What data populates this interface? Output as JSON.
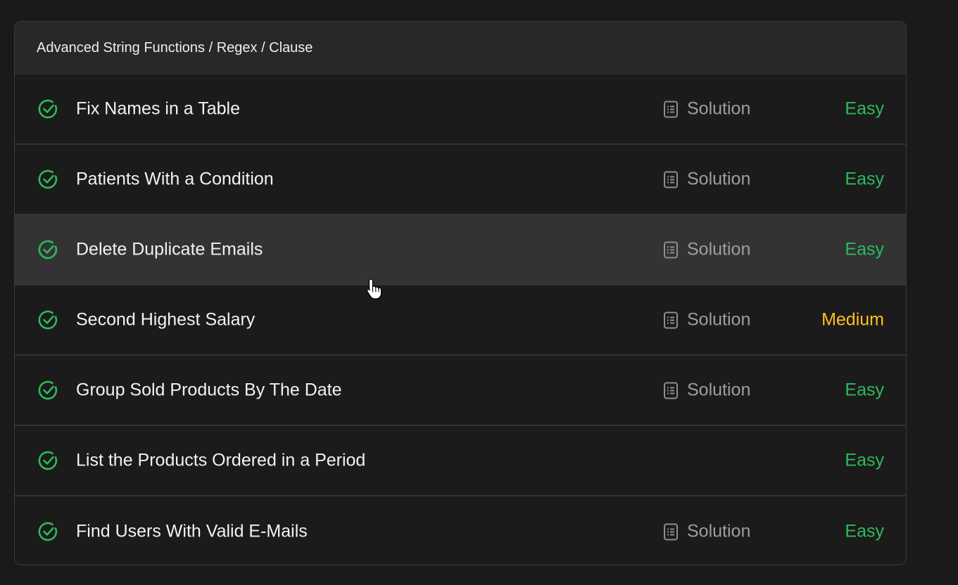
{
  "section": {
    "title": "Advanced String Functions / Regex / Clause"
  },
  "colors": {
    "background": "#1a1a1a",
    "card": "#1b1b1b",
    "header": "#282828",
    "hover_row": "#333333",
    "check": "#2cbb5d",
    "easy": "#2cbb5d",
    "medium": "#ffc01e",
    "solution_text": "#9e9e9e"
  },
  "problems": [
    {
      "title": "Fix Names in a Table",
      "solution_label": "Solution",
      "difficulty": "Easy",
      "status": "solved"
    },
    {
      "title": "Patients With a Condition",
      "solution_label": "Solution",
      "difficulty": "Easy",
      "status": "solved"
    },
    {
      "title": "Delete Duplicate Emails",
      "solution_label": "Solution",
      "difficulty": "Easy",
      "status": "solved"
    },
    {
      "title": "Second Highest Salary",
      "solution_label": "Solution",
      "difficulty": "Medium",
      "status": "solved"
    },
    {
      "title": "Group Sold Products By The Date",
      "solution_label": "Solution",
      "difficulty": "Easy",
      "status": "solved"
    },
    {
      "title": "List the Products Ordered in a Period",
      "solution_label": "",
      "difficulty": "Easy",
      "status": "solved"
    },
    {
      "title": "Find Users With Valid E-Mails",
      "solution_label": "Solution",
      "difficulty": "Easy",
      "status": "solved"
    }
  ],
  "icons": {
    "status": "check-circle-icon",
    "solution": "document-icon",
    "cursor": "hand-pointer-cursor"
  }
}
